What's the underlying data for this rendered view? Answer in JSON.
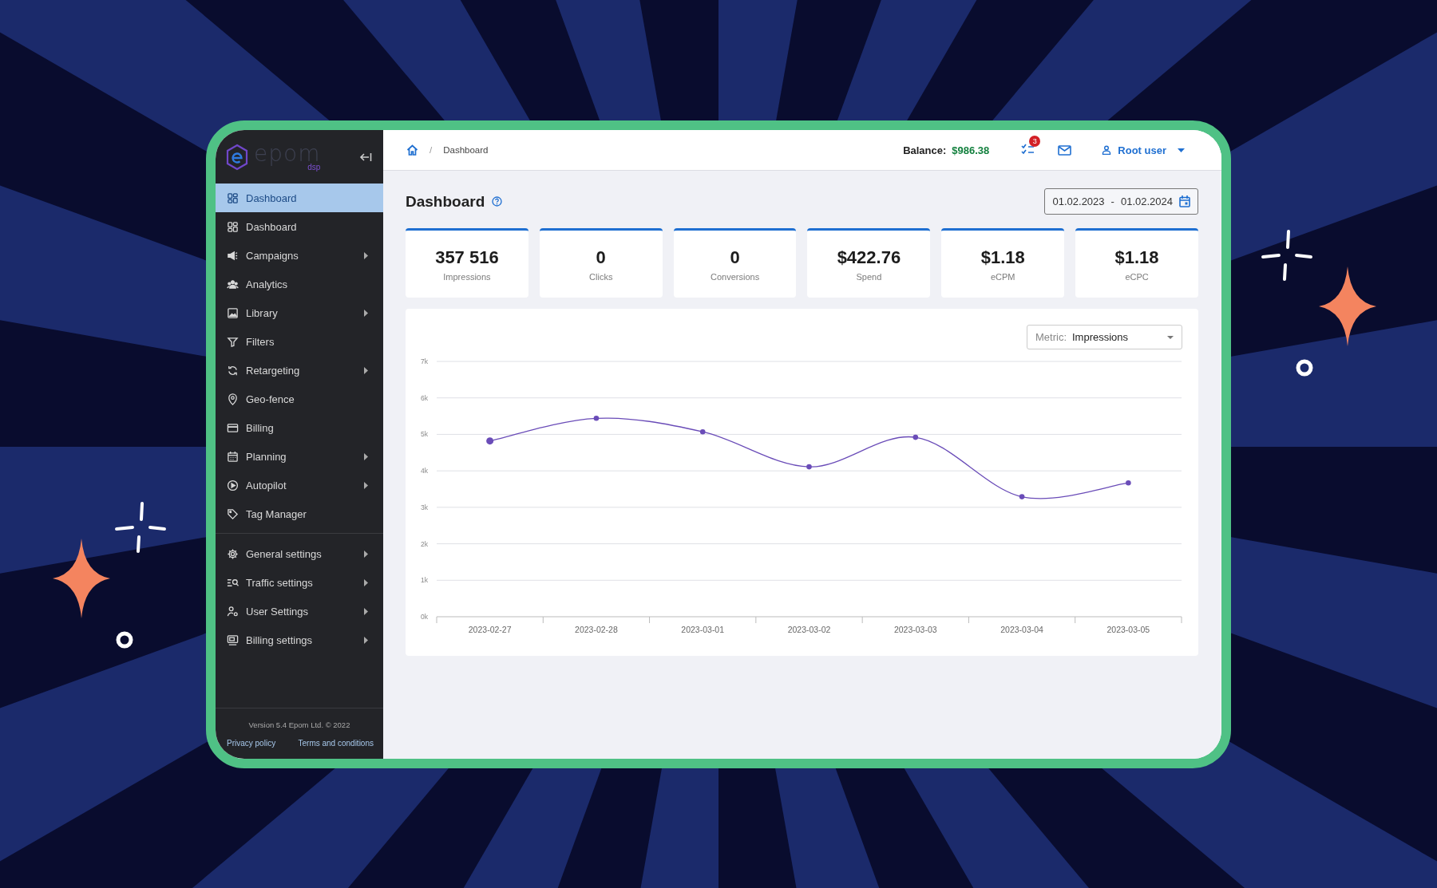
{
  "sidebar": {
    "logo": {
      "name": "epom",
      "sub": "dsp"
    },
    "items": [
      {
        "label": "Dashboard",
        "selected": true,
        "expandable": false
      },
      {
        "label": "Dashboard",
        "selected": false,
        "expandable": false
      },
      {
        "label": "Campaigns",
        "selected": false,
        "expandable": true
      },
      {
        "label": "Analytics",
        "selected": false,
        "expandable": false
      },
      {
        "label": "Library",
        "selected": false,
        "expandable": true
      },
      {
        "label": "Filters",
        "selected": false,
        "expandable": false
      },
      {
        "label": "Retargeting",
        "selected": false,
        "expandable": true
      },
      {
        "label": "Geo-fence",
        "selected": false,
        "expandable": false
      },
      {
        "label": "Billing",
        "selected": false,
        "expandable": false
      },
      {
        "label": "Planning",
        "selected": false,
        "expandable": true
      },
      {
        "label": "Autopilot",
        "selected": false,
        "expandable": true
      },
      {
        "label": "Tag Manager",
        "selected": false,
        "expandable": false
      }
    ],
    "settings_items": [
      {
        "label": "General settings",
        "selected": false,
        "expandable": true
      },
      {
        "label": "Traffic settings",
        "selected": false,
        "expandable": true
      },
      {
        "label": "User Settings",
        "selected": false,
        "expandable": true
      },
      {
        "label": "Billing settings",
        "selected": false,
        "expandable": true
      }
    ],
    "footer": {
      "version": "Version 5.4 Epom Ltd. © 2022",
      "links": [
        "Privacy policy",
        "Terms and conditions"
      ]
    }
  },
  "header": {
    "breadcrumb": [
      "/",
      "Dashboard"
    ],
    "balance_label": "Balance:",
    "balance": "$986.38",
    "tasks_badge": "3",
    "user": "Root user"
  },
  "page": {
    "title": "Dashboard",
    "date_from": "01.02.2023",
    "date_separator": "-",
    "date_to": "01.02.2024",
    "stats": [
      {
        "value": "357 516",
        "label": "Impressions"
      },
      {
        "value": "0",
        "label": "Clicks"
      },
      {
        "value": "0",
        "label": "Conversions"
      },
      {
        "value": "$422.76",
        "label": "Spend"
      },
      {
        "value": "$1.18",
        "label": "eCPM"
      },
      {
        "value": "$1.18",
        "label": "eCPC"
      }
    ],
    "chart": {
      "metric_label": "Metric:",
      "metric": "Impressions",
      "chart_data": {
        "type": "line",
        "categories": [
          "2023-02-27",
          "2023-02-28",
          "2023-03-01",
          "2023-03-02",
          "2023-03-03",
          "2023-03-04",
          "2023-03-05"
        ],
        "series": [
          {
            "color": "#6a4cb8",
            "marker": true,
            "values": [
              4820,
              5440,
              5070,
              4110,
              4920,
              3290,
              3670
            ]
          }
        ],
        "grid": true,
        "ylim": [
          0,
          7000
        ],
        "yticks": [
          {
            "value": 0,
            "label": "0k"
          },
          {
            "value": 1000,
            "label": "1k"
          },
          {
            "value": 2000,
            "label": "2k"
          },
          {
            "value": 3000,
            "label": "3k"
          },
          {
            "value": 4000,
            "label": "4k"
          },
          {
            "value": 5000,
            "label": "5k"
          },
          {
            "value": 6000,
            "label": "6k"
          },
          {
            "value": 7000,
            "label": "7k"
          }
        ]
      }
    }
  }
}
